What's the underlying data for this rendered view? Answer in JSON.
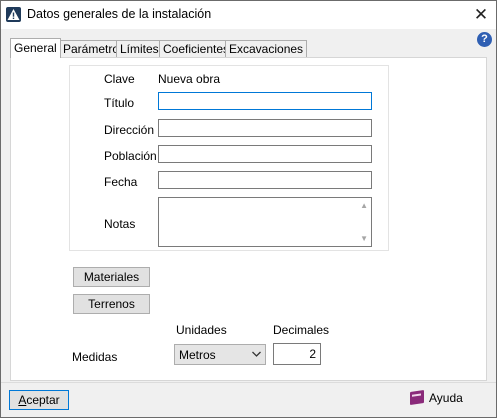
{
  "window": {
    "title": "Datos generales de la instalación",
    "close_glyph": "✕",
    "help_glyph": "?"
  },
  "tabs": [
    {
      "label": "General",
      "active": true
    },
    {
      "label": "Parámetros",
      "active": false
    },
    {
      "label": "Límites",
      "active": false
    },
    {
      "label": "Coeficientes",
      "active": false
    },
    {
      "label": "Excavaciones",
      "active": false
    }
  ],
  "general": {
    "clave_label": "Clave",
    "clave_value": "Nueva obra",
    "titulo_label": "Título",
    "titulo_value": "",
    "direccion_label": "Dirección",
    "direccion_value": "",
    "poblacion_label": "Población",
    "poblacion_value": "",
    "fecha_label": "Fecha",
    "fecha_value": "",
    "notas_label": "Notas",
    "notas_value": ""
  },
  "buttons": {
    "materiales": "Materiales",
    "terrenos": "Terrenos"
  },
  "medidas": {
    "label": "Medidas",
    "unidades_header": "Unidades",
    "decimales_header": "Decimales",
    "unidades_value": "Metros",
    "decimales_value": "2"
  },
  "footer": {
    "ok_first": "A",
    "ok_rest": "ceptar",
    "help_label": "Ayuda"
  },
  "icons": {
    "app": "warning-triangle-icon",
    "close": "close-icon",
    "help": "help-icon",
    "dropdown": "chevron-down-icon",
    "book": "book-icon"
  },
  "colors": {
    "focus_border": "#0078d7",
    "window_bg": "#f0f0f0",
    "panel_bg": "#ffffff",
    "help_circle": "#2f5fb3",
    "book": "#8a2a7a"
  }
}
